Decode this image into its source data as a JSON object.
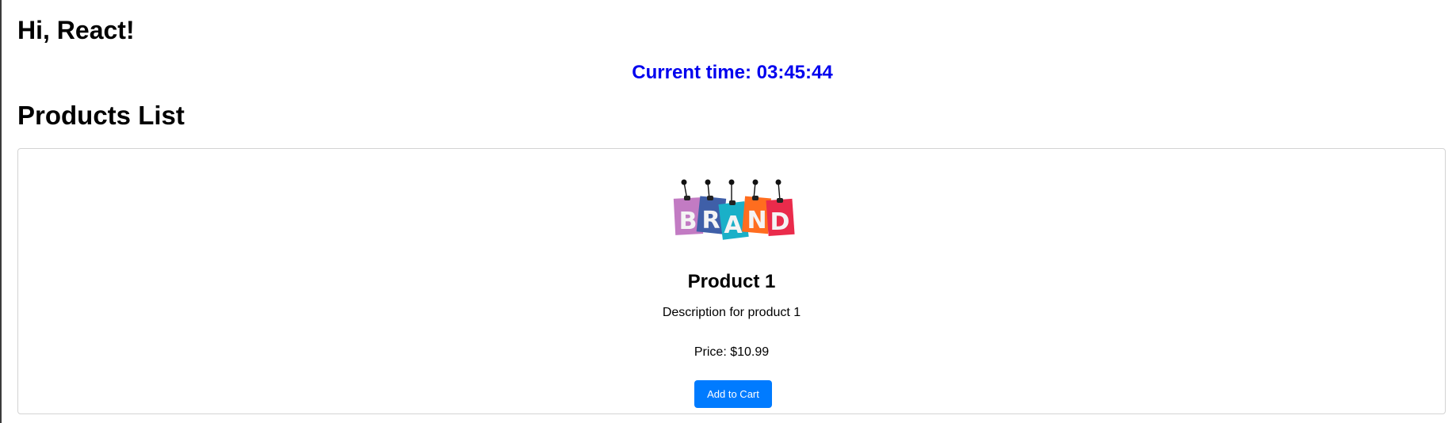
{
  "header": {
    "greeting": "Hi, React!"
  },
  "clock": {
    "text": "Current time: 03:45:44",
    "color": "#0000ee"
  },
  "products_section": {
    "title": "Products List",
    "products": [
      {
        "image_icon": "brand-tags-image",
        "image_letters": "BRAND",
        "name": "Product 1",
        "description": "Description for product 1",
        "price_text": "Price: $10.99",
        "button_label": "Add to Cart",
        "button_color": "#007bff"
      }
    ]
  }
}
